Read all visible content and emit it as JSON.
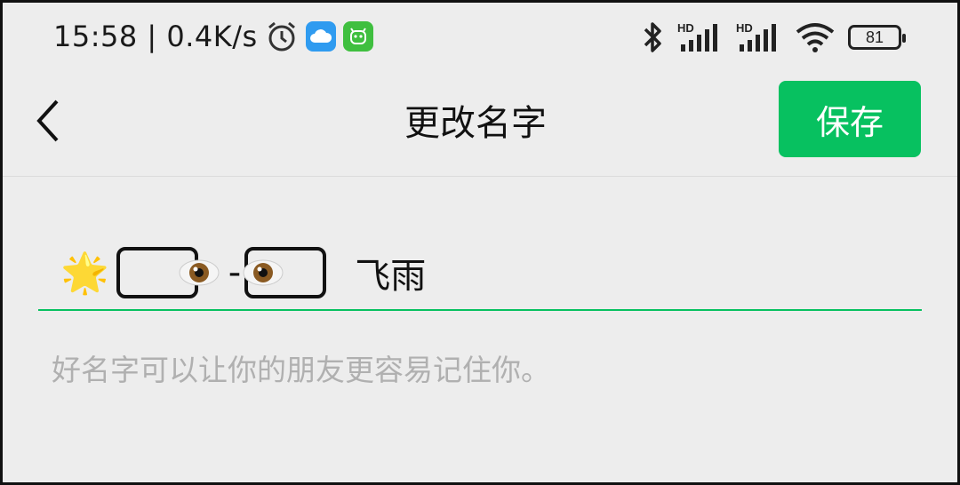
{
  "status_bar": {
    "time_speed": "15:58 | 0.4K/s",
    "signal_labels": [
      "HD",
      "HD"
    ],
    "battery": "81",
    "icons": [
      "alarm-icon",
      "cloud-app-icon",
      "green-app-icon",
      "bluetooth-icon",
      "signal-icon",
      "signal-icon",
      "wifi-icon",
      "battery-icon"
    ]
  },
  "header": {
    "title": "更改名字",
    "save_label": "保存"
  },
  "name_input": {
    "prefix_emoji": "🌟",
    "separator": "-",
    "text": "飞雨"
  },
  "hint": "好名字可以让你的朋友更容易记住你。",
  "colors": {
    "accent": "#07c160",
    "background": "#ededed"
  }
}
